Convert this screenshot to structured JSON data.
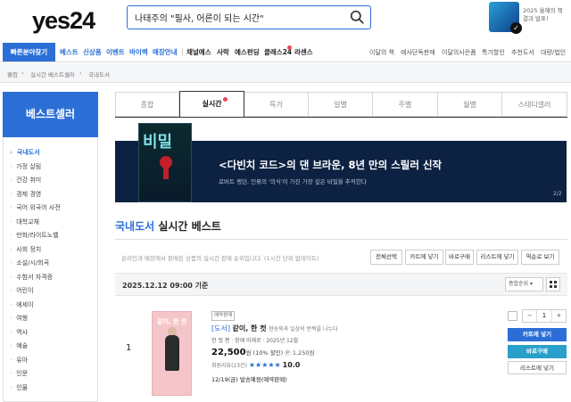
{
  "header": {
    "logo": "yes24",
    "search_query": "나태주의 \"필사, 어른이 되는 시간\"",
    "banner_text_1": "2025 올해의 책",
    "banner_text_2": "결과 발표!",
    "brand_color": "#2b6fd6"
  },
  "gnb": {
    "quick": "빠른분야찾기",
    "blue_items": [
      "베스트",
      "신상품",
      "이벤트",
      "바이백",
      "매장안내"
    ],
    "black_items": [
      "채널예스",
      "사락",
      "예스펀딩",
      "클래스24",
      "라센스"
    ],
    "right_items": [
      "이달의 책",
      "예사단독판매",
      "이달의사은품",
      "특가할인",
      "추천도서",
      "대량/법인"
    ]
  },
  "breadcrumb": [
    "웰컴",
    "실시간 베스트셀러",
    "국내도서"
  ],
  "sidebar": {
    "title": "베스트셀러",
    "items": [
      "국내도서",
      "가정 살림",
      "건강 취미",
      "경제 경영",
      "국어 외국어 사전",
      "대학교재",
      "만화/라이트노벨",
      "사회 정치",
      "소설/시/희곡",
      "수험서 자격증",
      "어린이",
      "에세이",
      "여행",
      "역사",
      "예술",
      "유아",
      "인문",
      "인물"
    ]
  },
  "tabs": [
    "종합",
    "실시간",
    "특가",
    "일별",
    "주별",
    "월별",
    "스테디셀러"
  ],
  "promo": {
    "cover_title": "비밀",
    "headline": "<다빈치 코드>의 댄 브라운, 8년 만의 스릴러 신작",
    "subline": "로버트 랭던, 인류의 '의식'이 가진 가장 깊은 비밀을 추적한다",
    "page": "2/2"
  },
  "section": {
    "title_blue": "국내도서",
    "title_rest": " 실시간 베스트",
    "desc": "온라인과 매장에서 판매된 상품의 실시간 판매 순위입니다. (1시간 단위 업데이트)",
    "buttons": [
      "전체선택",
      "카트에 넣기",
      "바로구매",
      "리스트에 넣기",
      "역순로 보기"
    ],
    "date": "2025.12.12 09:00 기준",
    "sort": "종합순위"
  },
  "product": {
    "rank": "1",
    "cover_text": "같이, 한 컷",
    "badge": "예약판매",
    "category": "[도서]",
    "name": "같이, 한 컷",
    "subtitle": "현송욱과 일상의 반짝을 나누다",
    "author": "한 컷 편 · 함께 미래로 · 2025년 12월",
    "price": "22,500",
    "price_unit": "원",
    "discount": "(10% 할인)",
    "points": "1,250원",
    "rating_label": "회원리뷰(23건)",
    "stars": "★★★★★",
    "score": "10.0",
    "shipping": "12/19(금) 발송예정(예약판매)",
    "qty": "1",
    "btn_cart": "카트에 넣기",
    "btn_buy": "바로구매",
    "btn_list": "리스트에 넣기"
  }
}
